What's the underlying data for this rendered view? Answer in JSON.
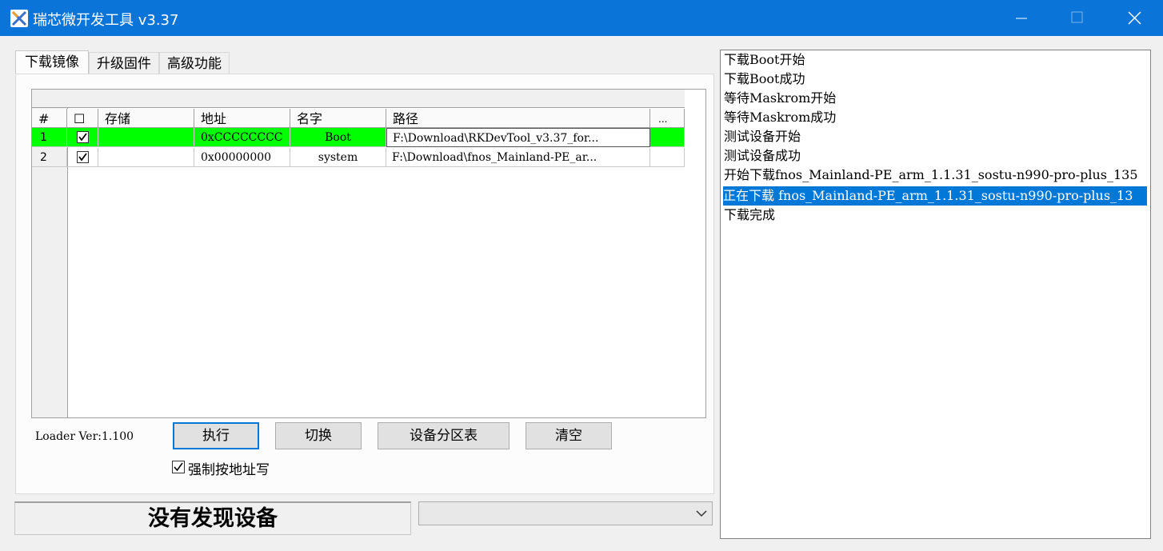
{
  "window": {
    "title": "瑞芯微开发工具 v3.37"
  },
  "tabs": [
    {
      "label": "下载镜像",
      "active": true
    },
    {
      "label": "升级固件",
      "active": false
    },
    {
      "label": "高级功能",
      "active": false
    }
  ],
  "table": {
    "headers": {
      "num": "#",
      "check": "☐",
      "storage": "存储",
      "address": "地址",
      "name": "名字",
      "path": "路径",
      "more": "..."
    },
    "rows": [
      {
        "num": "1",
        "checked": true,
        "storage": "",
        "address": "0xCCCCCCCC",
        "name": "Boot",
        "path": "F:\\Download\\RKDevTool_v3.37_for...",
        "highlight_color": "#00ff00"
      },
      {
        "num": "2",
        "checked": true,
        "storage": "",
        "address": "0x00000000",
        "name": "system",
        "path": "F:\\Download\\fnos_Mainland-PE_ar..."
      }
    ]
  },
  "loader_version": "Loader Ver:1.100",
  "buttons": {
    "run": "执行",
    "switch": "切换",
    "partition": "设备分区表",
    "clear": "清空"
  },
  "force_write": {
    "label": "强制按地址写",
    "checked": true
  },
  "status": "没有发现设备",
  "device_select": {
    "selected": ""
  },
  "log": [
    "下载Boot开始",
    "下载Boot成功",
    "等待Maskrom开始",
    "等待Maskrom成功",
    "测试设备开始",
    "测试设备成功",
    "开始下载fnos_Mainland-PE_arm_1.1.31_sostu-n990-pro-plus_135",
    "正在下载 fnos_Mainland-PE_arm_1.1.31_sostu-n990-pro-plus_13",
    "下载完成"
  ],
  "log_selected_index": 7,
  "colors": {
    "titlebar": "#0b74d8",
    "selection": "#0078d7",
    "boot_row": "#00ff00"
  }
}
